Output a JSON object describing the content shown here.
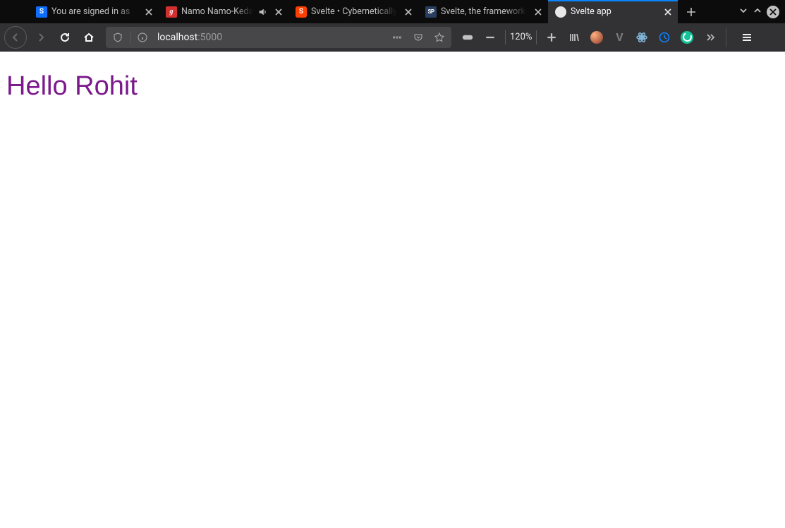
{
  "tabs": [
    {
      "title": "You are signed in as",
      "favicon_letter": "S",
      "favicon_class": "fav-blue",
      "audio": false
    },
    {
      "title": "Namo Namo-Kedarnath",
      "favicon_letter": "g",
      "favicon_class": "fav-red",
      "audio": true
    },
    {
      "title": "Svelte • Cybernetically",
      "favicon_letter": "S",
      "favicon_class": "fav-orange",
      "audio": false
    },
    {
      "title": "Svelte, the framework",
      "favicon_letter": "SP",
      "favicon_class": "fav-sp",
      "audio": false
    },
    {
      "title": "Svelte app",
      "favicon_letter": "",
      "favicon_class": "fav-svelte-app",
      "audio": false
    }
  ],
  "active_tab_index": 4,
  "url": {
    "host": "localhost",
    "port": ":5000"
  },
  "zoom": "120%",
  "page": {
    "heading": "Hello Rohit"
  }
}
